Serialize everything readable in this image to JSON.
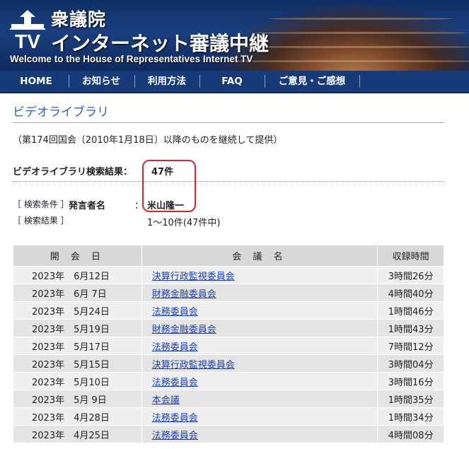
{
  "header": {
    "site_name": "衆議院",
    "site_subtitle": "インターネット審議中継",
    "site_english": "Welcome to the House of Representatives Internet TV",
    "logo_text": "TV"
  },
  "nav": {
    "items": [
      {
        "label": "HOME"
      },
      {
        "label": "お知らせ"
      },
      {
        "label": "利用方法"
      },
      {
        "label": "FAQ"
      },
      {
        "label": "ご意見・ご感想"
      }
    ]
  },
  "main": {
    "title": "ビデオライブラリ",
    "notice": "（第174回国会〔2010年1月18日〕以降のものを継続して提供）",
    "result_label": "ビデオライブラリ検索結果：",
    "result_count": "47件",
    "conditions_tag": "［ 検索条件 ］",
    "condition_key": "発言者名",
    "condition_colon": "：",
    "condition_value": "米山隆一",
    "results_tag": "［ 検索結果 ］",
    "results_range": "1～10件(47件中)"
  },
  "table": {
    "headers": [
      "開 会 日",
      "会 議 名",
      "収録時間"
    ],
    "rows": [
      {
        "date": "2023年　6月12日",
        "name": "決算行政監視委員会",
        "duration": "3時間26分"
      },
      {
        "date": "2023年　6月 7日",
        "name": "財務金融委員会",
        "duration": "4時間40分"
      },
      {
        "date": "2023年　5月24日",
        "name": "法務委員会",
        "duration": "1時間46分"
      },
      {
        "date": "2023年　5月19日",
        "name": "財務金融委員会",
        "duration": "1時間43分"
      },
      {
        "date": "2023年　5月17日",
        "name": "法務委員会",
        "duration": "7時間12分"
      },
      {
        "date": "2023年　5月15日",
        "name": "決算行政監視委員会",
        "duration": "3時間04分"
      },
      {
        "date": "2023年　5月10日",
        "name": "法務委員会",
        "duration": "3時間16分"
      },
      {
        "date": "2023年　5月 9日",
        "name": "本会議",
        "duration": "1時間35分"
      },
      {
        "date": "2023年　4月28日",
        "name": "法務委員会",
        "duration": "1時間34分"
      },
      {
        "date": "2023年　4月25日",
        "name": "法務委員会",
        "duration": "4時間08分"
      }
    ]
  }
}
